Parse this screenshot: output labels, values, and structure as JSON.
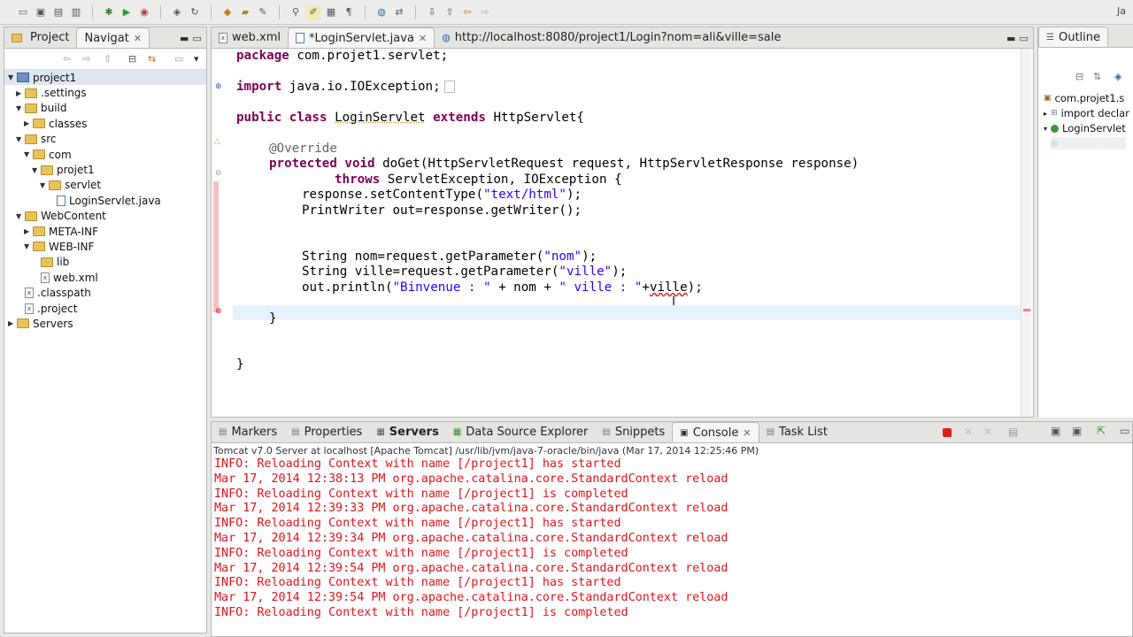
{
  "colors": {
    "error": "#e0141a",
    "keyword": "#7f0055",
    "string": "#2a00ff",
    "annotation": "#646464"
  },
  "toolbar": {
    "right_label": "Ja"
  },
  "left": {
    "tabs": [
      {
        "label": "Project"
      },
      {
        "label": "Navigat",
        "close": "✕"
      }
    ],
    "tree": [
      {
        "label": "project1",
        "icon": "project-icon",
        "indent": 0,
        "expanded": true
      },
      {
        "label": ".settings",
        "icon": "folder-icon",
        "indent": 1,
        "expanded": false
      },
      {
        "label": "build",
        "icon": "folder-icon",
        "indent": 1,
        "expanded": true
      },
      {
        "label": "classes",
        "icon": "folder-icon",
        "indent": 2,
        "expanded": false
      },
      {
        "label": "src",
        "icon": "folder-icon",
        "indent": 1,
        "expanded": true
      },
      {
        "label": "com",
        "icon": "folder-icon",
        "indent": 2,
        "expanded": true
      },
      {
        "label": "projet1",
        "icon": "folder-icon",
        "indent": 3,
        "expanded": true
      },
      {
        "label": "servlet",
        "icon": "folder-icon",
        "indent": 4,
        "expanded": true
      },
      {
        "label": "LoginServlet.java",
        "icon": "java-file-icon",
        "indent": 5,
        "expanded": null
      },
      {
        "label": "WebContent",
        "icon": "folder-icon",
        "indent": 1,
        "expanded": true
      },
      {
        "label": "META-INF",
        "icon": "folder-icon",
        "indent": 2,
        "expanded": false
      },
      {
        "label": "WEB-INF",
        "icon": "folder-icon",
        "indent": 2,
        "expanded": true
      },
      {
        "label": "lib",
        "icon": "folder-icon",
        "indent": 3,
        "expanded": null
      },
      {
        "label": "web.xml",
        "icon": "xml-file-icon",
        "indent": 3,
        "expanded": null
      },
      {
        "label": ".classpath",
        "icon": "xml-file-icon",
        "indent": 1,
        "expanded": null
      },
      {
        "label": ".project",
        "icon": "xml-file-icon",
        "indent": 1,
        "expanded": null
      },
      {
        "label": "Servers",
        "icon": "folder-icon",
        "indent": 0,
        "expanded": false
      }
    ]
  },
  "editor": {
    "tabs": [
      {
        "label": "web.xml"
      },
      {
        "label": "*LoginServlet.java",
        "close": "✕"
      },
      {
        "label": "http://localhost:8080/project1/Login?nom=ali&ville=sale"
      }
    ],
    "code": {
      "l1": {
        "kw": "package",
        "rest": " com.projet1.servlet;"
      },
      "l2": {
        "kw": "import",
        "rest": " java.io.IOException;"
      },
      "l3": {
        "kw1": "public",
        "kw2": "class",
        "name": "LoginServlet",
        "kw3": "extends",
        "rest": " HttpServlet{"
      },
      "l4": {
        "ann": "@Override"
      },
      "l5": {
        "kw1": "protected",
        "kw2": "void",
        "rest": " doGet(HttpServletRequest request, HttpServletResponse response)"
      },
      "l6": {
        "kw": "throws",
        "rest": " ServletException, IOException {"
      },
      "l7": {
        "pre": "response.setContentType(",
        "str": "\"text/html\"",
        "post": ");"
      },
      "l8": {
        "text": "PrintWriter out=response.getWriter();"
      },
      "l9": {
        "pre": "String nom=request.getParameter(",
        "str": "\"nom\"",
        "post": ");"
      },
      "l10": {
        "pre": "String ville=request.getParameter(",
        "str": "\"ville\"",
        "post": ");"
      },
      "l11": {
        "pre": "out.println(",
        "s1": "\"Binvenue : \"",
        "mid1": " + nom + ",
        "s2": "\" ville : \"",
        "mid2": "+",
        "err": "ville",
        "post": ");"
      },
      "l12": {
        "text": "}"
      },
      "l13": {
        "text": "}"
      }
    }
  },
  "outline": {
    "tab": "Outline",
    "items": [
      {
        "label": "com.projet1.s"
      },
      {
        "label": "import declar"
      },
      {
        "label": "LoginServlet"
      },
      {
        "label": "doGet(HttpS"
      }
    ]
  },
  "console": {
    "tabs": [
      {
        "label": "Markers"
      },
      {
        "label": "Properties"
      },
      {
        "label": "Servers"
      },
      {
        "label": "Data Source Explorer"
      },
      {
        "label": "Snippets"
      },
      {
        "label": "Console",
        "close": "✕"
      },
      {
        "label": "Task List"
      }
    ],
    "header": "Tomcat v7.0 Server at localhost [Apache Tomcat] /usr/lib/jvm/java-7-oracle/bin/java (Mar 17, 2014 12:25:46 PM)",
    "lines": [
      "INFO: Reloading Context with name [/project1] has started",
      "Mar 17, 2014 12:38:13 PM org.apache.catalina.core.StandardContext reload",
      "INFO: Reloading Context with name [/project1] is completed",
      "Mar 17, 2014 12:39:33 PM org.apache.catalina.core.StandardContext reload",
      "INFO: Reloading Context with name [/project1] has started",
      "Mar 17, 2014 12:39:34 PM org.apache.catalina.core.StandardContext reload",
      "INFO: Reloading Context with name [/project1] is completed",
      "Mar 17, 2014 12:39:54 PM org.apache.catalina.core.StandardContext reload",
      "INFO: Reloading Context with name [/project1] has started",
      "Mar 17, 2014 12:39:54 PM org.apache.catalina.core.StandardContext reload",
      "INFO: Reloading Context with name [/project1] is completed"
    ]
  }
}
